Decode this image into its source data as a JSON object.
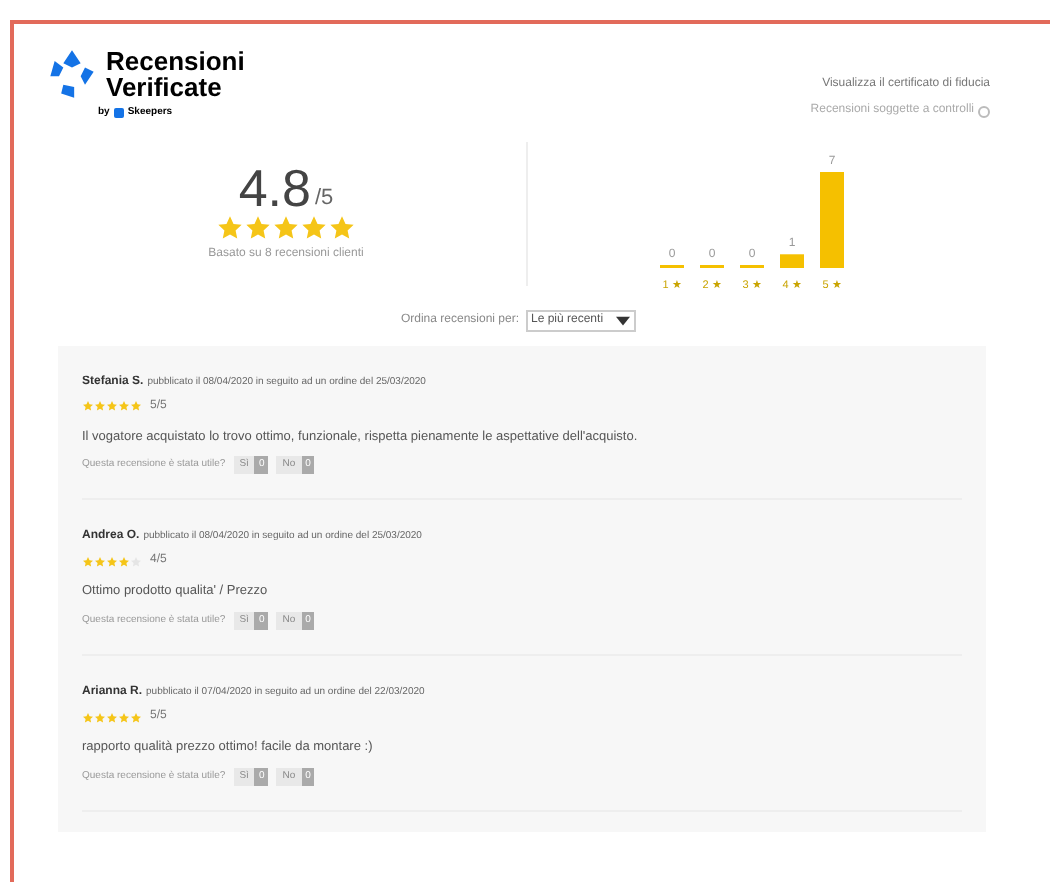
{
  "header": {
    "logo_title": "Recensioni Verificate",
    "logo_by": "by",
    "logo_brand": "Skeepers",
    "certificate_link": "Visualizza il certificato di fiducia",
    "control_note": "Recensioni soggette a controlli"
  },
  "summary": {
    "score": "4.8",
    "out_of": "/5",
    "stars": 5,
    "based_on": "Basato su 8 recensioni clienti",
    "chart_data": {
      "type": "bar",
      "categories": [
        "1 ★",
        "2 ★",
        "3 ★",
        "4 ★",
        "5 ★"
      ],
      "values": [
        0,
        0,
        0,
        1,
        7
      ],
      "data_labels": true
    }
  },
  "sort": {
    "label": "Ordina recensioni per:",
    "value": "Le più recenti"
  },
  "reviews": [
    {
      "author": "Stefania S.",
      "meta": "pubblicato il 08/04/2020 in seguito ad un ordine del 25/03/2020",
      "stars": 5,
      "score": "5/5",
      "text": "Il vogatore acquistato lo trovo ottimo, funzionale, rispetta pienamente le aspettative dell'acquisto.",
      "helpful_question": "Questa recensione è stata utile?",
      "yes_label": "Sì",
      "yes_count": "0",
      "no_label": "No",
      "no_count": "0"
    },
    {
      "author": "Andrea O.",
      "meta": "pubblicato il 08/04/2020 in seguito ad un ordine del 25/03/2020",
      "stars": 4,
      "score": "4/5",
      "text": "Ottimo prodotto qualita' / Prezzo",
      "helpful_question": "Questa recensione è stata utile?",
      "yes_label": "Sì",
      "yes_count": "0",
      "no_label": "No",
      "no_count": "0"
    },
    {
      "author": "Arianna R.",
      "meta": "pubblicato il 07/04/2020 in seguito ad un ordine del 22/03/2020",
      "stars": 5,
      "score": "5/5",
      "text": "rapporto qualità prezzo ottimo! facile da montare :)",
      "helpful_question": "Questa recensione è stata utile?",
      "yes_label": "Sì",
      "yes_count": "0",
      "no_label": "No",
      "no_count": "0"
    }
  ]
}
